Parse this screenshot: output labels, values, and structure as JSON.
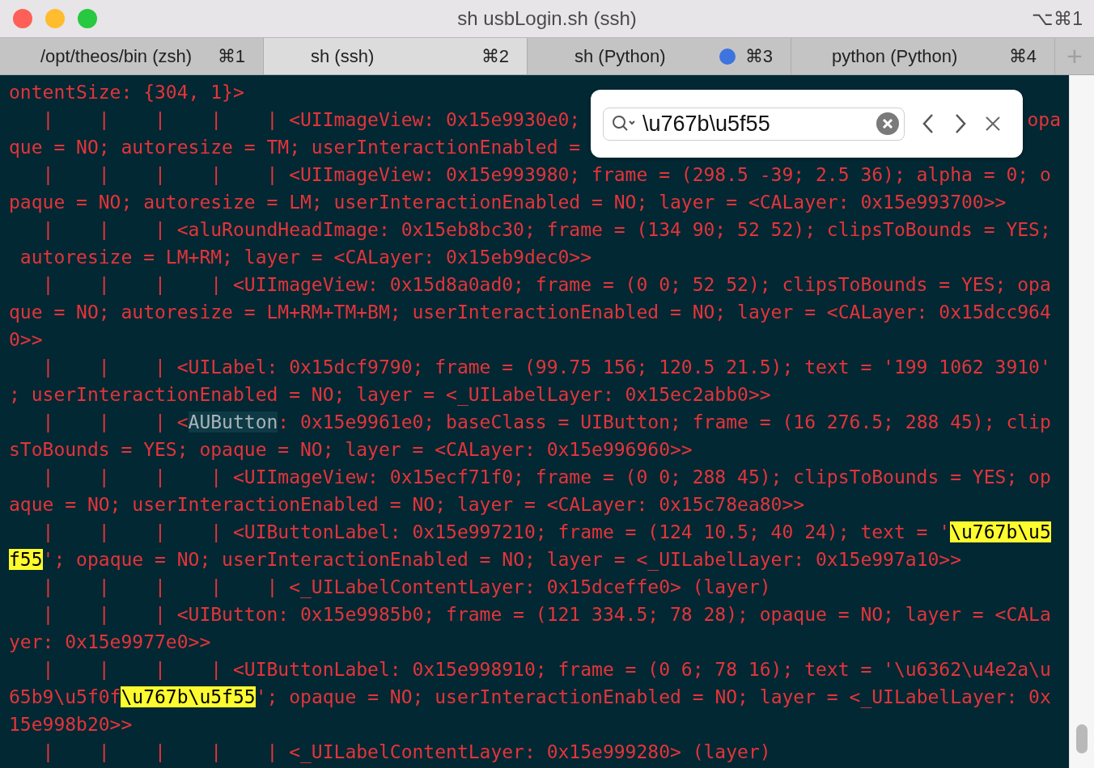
{
  "window": {
    "title": "sh usbLogin.sh (ssh)",
    "shortcut": "⌥⌘1"
  },
  "tabs": [
    {
      "label": "/opt/theos/bin (zsh)",
      "shortcut": "⌘1",
      "selected": false,
      "activity": false
    },
    {
      "label": "sh (ssh)",
      "shortcut": "⌘2",
      "selected": true,
      "activity": false
    },
    {
      "label": "sh (Python)",
      "shortcut": "⌘3",
      "selected": false,
      "activity": true
    },
    {
      "label": "python (Python)",
      "shortcut": "⌘4",
      "selected": false,
      "activity": false
    }
  ],
  "new_tab": "+",
  "find_bar": {
    "value": "\\u767b\\u5f55"
  },
  "lines": [
    {
      "segments": [
        {
          "kind": "plain",
          "text": "ontentSize: {304, 1}>"
        }
      ]
    },
    {
      "segments": [
        {
          "kind": "plain",
          "text": "   |    |    |    |    | <UIImageView: 0x15e9930e0;"
        }
      ],
      "right": "opa"
    },
    {
      "segments": [
        {
          "kind": "plain",
          "text": "que = NO; autoresize = TM; userInteractionEnabled ="
        }
      ]
    },
    {
      "segments": [
        {
          "kind": "plain",
          "text": "   |    |    |    |    | <UIImageView: 0x15e993980; frame = (298.5 -39; 2.5 36); alpha = 0; o"
        }
      ]
    },
    {
      "segments": [
        {
          "kind": "plain",
          "text": "paque = NO; autoresize = LM; userInteractionEnabled = NO; layer = <CALayer: 0x15e993700>>"
        }
      ]
    },
    {
      "segments": [
        {
          "kind": "plain",
          "text": "   |    |    | <aluRoundHeadImage: 0x15eb8bc30; frame = (134 90; 52 52); clipsToBounds = YES;"
        }
      ]
    },
    {
      "segments": [
        {
          "kind": "plain",
          "text": " autoresize = LM+RM; layer = <CALayer: 0x15eb9dec0>>"
        }
      ]
    },
    {
      "segments": [
        {
          "kind": "plain",
          "text": "   |    |    |    | <UIImageView: 0x15d8a0ad0; frame = (0 0; 52 52); clipsToBounds = YES; opa"
        }
      ]
    },
    {
      "segments": [
        {
          "kind": "plain",
          "text": "que = NO; autoresize = LM+RM+TM+BM; userInteractionEnabled = NO; layer = <CALayer: 0x15dcc964"
        }
      ]
    },
    {
      "segments": [
        {
          "kind": "plain",
          "text": "0>>"
        }
      ]
    },
    {
      "segments": [
        {
          "kind": "plain",
          "text": "   |    |    | <UILabel: 0x15dcf9790; frame = (99.75 156; 120.5 21.5); text = '199 1062 3910'"
        }
      ]
    },
    {
      "segments": [
        {
          "kind": "plain",
          "text": "; userInteractionEnabled = NO; layer = <_UILabelLayer: 0x15ec2abb0>>"
        }
      ]
    },
    {
      "segments": [
        {
          "kind": "plain",
          "text": "   |    |    | <"
        },
        {
          "kind": "selection",
          "text": "AUButton"
        },
        {
          "kind": "plain",
          "text": ": 0x15e9961e0; baseClass = UIButton; frame = (16 276.5; 288 45); clip"
        }
      ]
    },
    {
      "segments": [
        {
          "kind": "plain",
          "text": "sToBounds = YES; opaque = NO; layer = <CALayer: 0x15e996960>>"
        }
      ]
    },
    {
      "segments": [
        {
          "kind": "plain",
          "text": "   |    |    |    | <UIImageView: 0x15ecf71f0; frame = (0 0; 288 45); clipsToBounds = YES; op"
        }
      ]
    },
    {
      "segments": [
        {
          "kind": "plain",
          "text": "aque = NO; userInteractionEnabled = NO; layer = <CALayer: 0x15c78ea80>>"
        }
      ]
    },
    {
      "segments": [
        {
          "kind": "plain",
          "text": "   |    |    |    | <UIButtonLabel: 0x15e997210; frame = (124 10.5; 40 24); text = '"
        },
        {
          "kind": "match",
          "text": "\\u767b\\u5"
        }
      ]
    },
    {
      "segments": [
        {
          "kind": "match",
          "text": "f55"
        },
        {
          "kind": "plain",
          "text": "'; opaque = NO; userInteractionEnabled = NO; layer = <_UILabelLayer: 0x15e997a10>>"
        }
      ]
    },
    {
      "segments": [
        {
          "kind": "plain",
          "text": "   |    |    |    |    | <_UILabelContentLayer: 0x15dceffe0> (layer)"
        }
      ]
    },
    {
      "segments": [
        {
          "kind": "plain",
          "text": "   |    |    | <UIButton: 0x15e9985b0; frame = (121 334.5; 78 28); opaque = NO; layer = <CALa"
        }
      ]
    },
    {
      "segments": [
        {
          "kind": "plain",
          "text": "yer: 0x15e9977e0>>"
        }
      ]
    },
    {
      "segments": [
        {
          "kind": "plain",
          "text": "   |    |    |    | <UIButtonLabel: 0x15e998910; frame = (0 6; 78 16); text = '\\u6362\\u4e2a\\u"
        }
      ]
    },
    {
      "segments": [
        {
          "kind": "plain",
          "text": "65b9\\u5f0f"
        },
        {
          "kind": "match",
          "text": "\\u767b\\u5f55"
        },
        {
          "kind": "plain",
          "text": "'; opaque = NO; userInteractionEnabled = NO; layer = <_UILabelLayer: 0x"
        }
      ]
    },
    {
      "segments": [
        {
          "kind": "plain",
          "text": "15e998b20>>"
        }
      ]
    },
    {
      "segments": [
        {
          "kind": "plain",
          "text": "   |    |    |    |    | <_UILabelContentLayer: 0x15e999280> (layer)"
        }
      ]
    }
  ]
}
